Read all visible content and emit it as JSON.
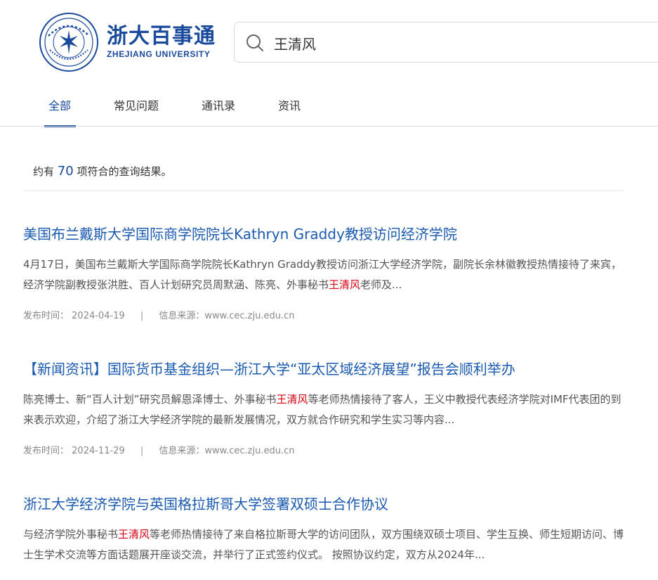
{
  "brand": {
    "name_cn": "浙大百事通",
    "name_en": "ZHEJIANG UNIVERSITY",
    "color": "#1a4a9c"
  },
  "search": {
    "query": "王清风",
    "icon": "search-icon"
  },
  "tabs": [
    {
      "label": "全部",
      "active": true
    },
    {
      "label": "常见问题",
      "active": false
    },
    {
      "label": "通讯录",
      "active": false
    },
    {
      "label": "资讯",
      "active": false
    }
  ],
  "result_count": {
    "prefix": "约有",
    "count": "70",
    "suffix": "项符合的查询结果。"
  },
  "results": [
    {
      "title": "美国布兰戴斯大学国际商学院院长Kathryn Graddy教授访问经济学院",
      "snippet_before": "4月17日，美国布兰戴斯大学国际商学院院长Kathryn Graddy教授访问浙江大学经济学院，副院长余林徽教授热情接待了来宾，经济学院副教授张洪胜、百人计划研究员周默涵、陈亮、外事秘书",
      "snippet_highlight": "王清风",
      "snippet_after": "老师及...",
      "date_label": "发布时间：",
      "date": "2024-04-19",
      "source_label": "信息来源：",
      "source": "www.cec.zju.edu.cn"
    },
    {
      "title": "【新闻资讯】国际货币基金组织—浙江大学“亚太区域经济展望”报告会顺利举办",
      "snippet_before": "陈亮博士、新“百人计划”研究员解恩泽博士、外事秘书",
      "snippet_highlight": "王清风",
      "snippet_after": "等老师热情接待了客人，王义中教授代表经济学院对IMF代表团的到来表示欢迎，介绍了浙江大学经济学院的最新发展情况，双方就合作研究和学生实习等内容...",
      "date_label": "发布时间：",
      "date": "2024-11-29",
      "source_label": "信息来源：",
      "source": "www.cec.zju.edu.cn"
    },
    {
      "title": "浙江大学经济学院与英国格拉斯哥大学签署双硕士合作协议",
      "snippet_before": "与经济学院外事秘书",
      "snippet_highlight": "王清风",
      "snippet_after": "等老师热情接待了来自格拉斯哥大学的访问团队，双方围绕双硕士项目、学生互换、师生短期访问、博士生学术交流等方面话题展开座谈交流，并举行了正式签约仪式。 按照协议约定，双方从2024年..."
    }
  ]
}
